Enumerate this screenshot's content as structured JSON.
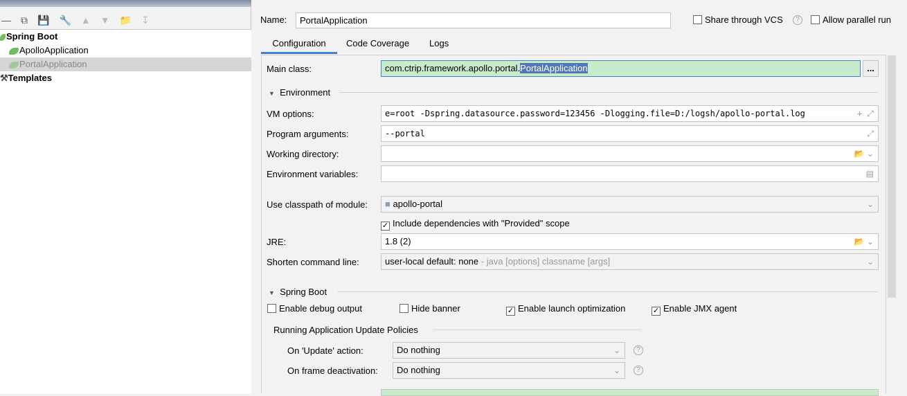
{
  "toolbar": {
    "icons": [
      "minus-icon",
      "copy-icon",
      "save-icon",
      "wrench-icon",
      "arrow-up-icon",
      "arrow-down-icon",
      "new-folder-icon",
      "sort-icon"
    ]
  },
  "tree": {
    "items": [
      {
        "label": "Spring Boot",
        "bold": true
      },
      {
        "label": "ApolloApplication"
      },
      {
        "label": "PortalApplication",
        "selected": true
      },
      {
        "label": "Templates",
        "bold": true
      }
    ]
  },
  "header": {
    "name_label": "Name:",
    "name_value": "PortalApplication",
    "share_vcs": "Share through VCS",
    "allow_parallel": "Allow parallel run"
  },
  "tabs": [
    "Configuration",
    "Code Coverage",
    "Logs"
  ],
  "config": {
    "main_class_label": "Main class:",
    "main_class_prefix": "com.ctrip.framework.apollo.portal.",
    "main_class_selected": "PortalApplication",
    "browse": "...",
    "environment": "Environment",
    "vm_label": "VM options:",
    "vm_value": "e=root -Dspring.datasource.password=123456 -Dlogging.file=D:/logsh/apollo-portal.log",
    "args_label": "Program arguments:",
    "args_value": "--portal",
    "wd_label": "Working directory:",
    "wd_value": "",
    "env_label": "Environment variables:",
    "env_value": "",
    "classpath_label": "Use classpath of module:",
    "classpath_value": "apollo-portal",
    "include_deps": "Include dependencies with \"Provided\" scope",
    "jre_label": "JRE:",
    "jre_value": "1.8 (2)",
    "shorten_label": "Shorten command line:",
    "shorten_value": "user-local default: none",
    "shorten_hint": " - java [options] classname [args]",
    "spring_boot": "Spring Boot",
    "debug": "Enable debug output",
    "hide_banner": "Hide banner",
    "launch_opt": "Enable launch optimization",
    "jmx": "Enable JMX agent",
    "policies": "Running Application Update Policies",
    "update_label": "On 'Update' action:",
    "update_value": "Do nothing",
    "frame_label": "On frame deactivation:",
    "frame_value": "Do nothing"
  },
  "colors": {
    "accent": "#4083c9",
    "selection": "#5277b7",
    "valid_field": "#c8ebcc"
  }
}
